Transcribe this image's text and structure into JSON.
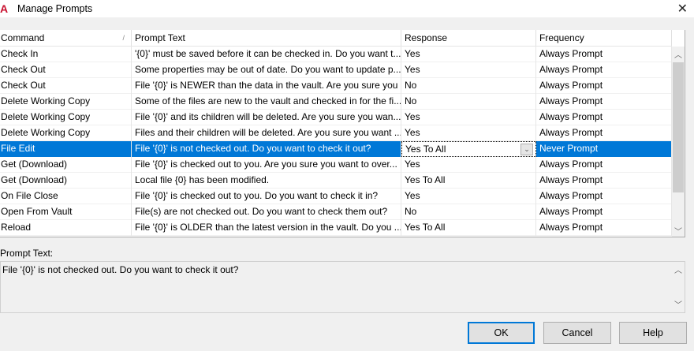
{
  "window": {
    "title": "Manage Prompts"
  },
  "grid": {
    "columns": [
      "Command",
      "Prompt Text",
      "Response",
      "Frequency"
    ],
    "rows": [
      {
        "command": "Check In",
        "prompt": "'{0}' must be saved before it can be checked in. Do you want t...",
        "response": "Yes",
        "frequency": "Always Prompt"
      },
      {
        "command": "Check Out",
        "prompt": "Some properties may be out of date. Do you want to update p...",
        "response": "Yes",
        "frequency": "Always Prompt"
      },
      {
        "command": "Check Out",
        "prompt": "File '{0}' is NEWER than the data in the vault. Are you sure you ...",
        "response": "No",
        "frequency": "Always Prompt"
      },
      {
        "command": "Delete Working Copy",
        "prompt": "Some of the files are new to the vault and checked in for the fi...",
        "response": "No",
        "frequency": "Always Prompt"
      },
      {
        "command": "Delete Working Copy",
        "prompt": "File '{0}' and its children will be deleted. Are you sure you wan...",
        "response": "Yes",
        "frequency": "Always Prompt"
      },
      {
        "command": "Delete Working Copy",
        "prompt": "Files and their children will be deleted. Are you sure you want ...",
        "response": "Yes",
        "frequency": "Always Prompt"
      },
      {
        "command": "File Edit",
        "prompt": "File '{0}' is not checked out. Do you want to check it out?",
        "response": "Yes To All",
        "frequency": "Never Prompt"
      },
      {
        "command": "Get (Download)",
        "prompt": "File '{0}' is checked out to you. Are you sure you want to over...",
        "response": "Yes",
        "frequency": "Always Prompt"
      },
      {
        "command": "Get (Download)",
        "prompt": "Local file {0} has been modified.",
        "response": "Yes To All",
        "frequency": "Always Prompt"
      },
      {
        "command": "On File Close",
        "prompt": "File '{0}' is checked out to you. Do you want to check it in?",
        "response": "Yes",
        "frequency": "Always Prompt"
      },
      {
        "command": "Open From Vault",
        "prompt": "File(s) are not checked out. Do you want to check them out?",
        "response": "No",
        "frequency": "Always Prompt"
      },
      {
        "command": "Reload",
        "prompt": "File '{0}' is OLDER than the latest version in the vault. Do you ...",
        "response": "Yes To All",
        "frequency": "Always Prompt"
      }
    ],
    "selected_index": 6
  },
  "detail": {
    "label": "Prompt Text:",
    "value": "File '{0}' is not checked out. Do you want to check it out?"
  },
  "buttons": {
    "ok": "OK",
    "cancel": "Cancel",
    "help": "Help"
  }
}
